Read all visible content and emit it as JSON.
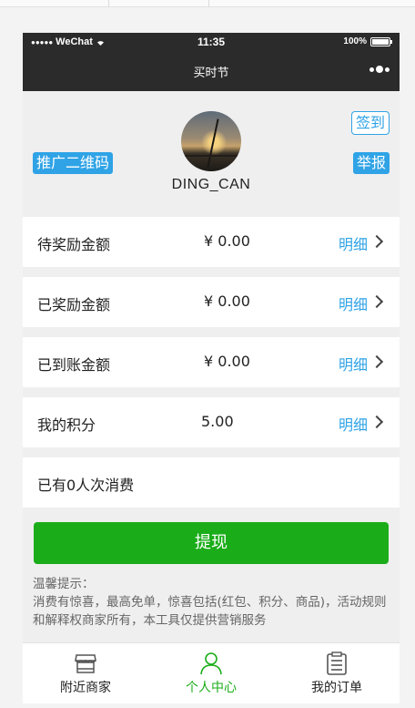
{
  "status_bar": {
    "carrier": "WeChat",
    "time": "11:35",
    "battery": "100%"
  },
  "nav": {
    "title": "买时节"
  },
  "profile": {
    "username": "DING_CAN",
    "qr_label": "推广二维码",
    "report_label": "举报",
    "signin_label": "签到"
  },
  "rows": [
    {
      "label": "待奖励金额",
      "value": "¥ 0.00",
      "detail": "明细"
    },
    {
      "label": "已奖励金额",
      "value": "¥ 0.00",
      "detail": "明细"
    },
    {
      "label": "已到账金额",
      "value": "¥ 0.00",
      "detail": "明细"
    },
    {
      "label": "我的积分",
      "value": "5.00",
      "detail": "明细"
    }
  ],
  "consume_count": "已有0人次消费",
  "withdraw_label": "提现",
  "notice": {
    "title": "温馨提示：",
    "body": "消费有惊喜，最高免单，惊喜包括(红包、积分、商品)，活动规则和解释权商家所有，本工具仅提供营销服务"
  },
  "tabbar": [
    {
      "label": "附近商家",
      "icon": "store-icon"
    },
    {
      "label": "个人中心",
      "icon": "person-icon",
      "active": true
    },
    {
      "label": "我的订单",
      "icon": "clipboard-icon"
    }
  ],
  "colors": {
    "accent_blue": "#2fa3e6",
    "wechat_green": "#1aad19",
    "navbar_dark": "#2b2b2b"
  }
}
